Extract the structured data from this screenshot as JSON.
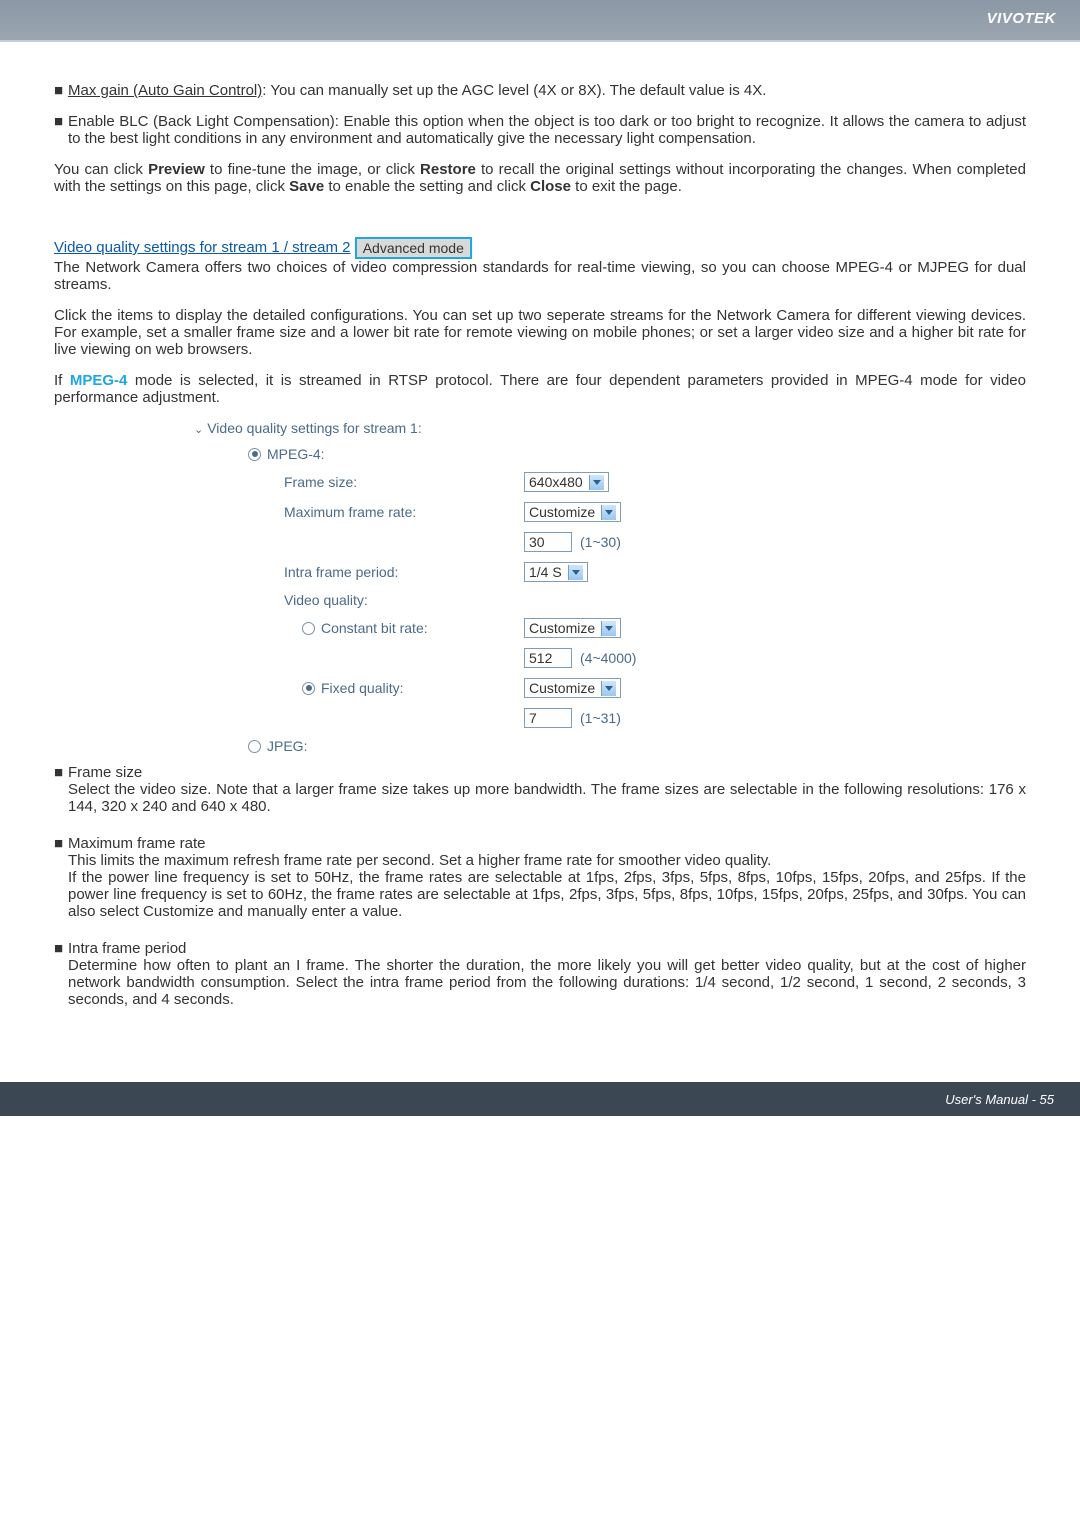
{
  "header": {
    "brand": "VIVOTEK"
  },
  "bullets_top": [
    {
      "lead": "Max gain (Auto Gain Control)",
      "rest": ": You can manually set up the AGC level (4X or 8X). The default value is 4X."
    },
    {
      "text": "Enable BLC (Back Light Compensation): Enable this option when the object is too dark or too bright to recognize. It allows the camera to adjust to the best light conditions in any environment and automatically give the necessary light compensation."
    }
  ],
  "para_preview": {
    "a": "You can click ",
    "b": "Preview",
    "c": " to fine-tune the image, or click ",
    "d": "Restore",
    "e": " to recall the original settings without incorporating the changes. When completed with the settings on this page, click ",
    "f": "Save",
    "g": " to enable the setting and click ",
    "h": "Close",
    "i": " to exit the page."
  },
  "section_link": "Video quality settings for stream 1 / stream 2",
  "adv_mode": "Advanced mode",
  "para_two_streams": "The Network Camera offers two choices of video compression standards for real-time viewing, so you can choose MPEG-4 or MJPEG for dual streams.",
  "para_click_items": "Click the items to display the detailed configurations. You can set up two seperate streams for the Network Camera for different viewing devices. For example, set a smaller frame size and a lower bit rate for remote viewing on mobile phones; or set a larger video size and a higher bit rate for live viewing on web browsers.",
  "para_mpeg": {
    "a": "If ",
    "b": "MPEG-4",
    "c": " mode is selected, it is streamed in RTSP protocol. There are four dependent parameters provided  in MPEG-4 mode for video performance adjustment."
  },
  "form": {
    "title": "Video quality settings for stream 1:",
    "mpeg4_label": "MPEG-4:",
    "jpeg_label": "JPEG:",
    "rows": {
      "frame_size": "Frame size:",
      "max_rate": "Maximum frame rate:",
      "intra": "Intra frame period:",
      "vq": "Video quality:",
      "cbr": "Constant bit rate:",
      "fq": "Fixed quality:"
    },
    "values": {
      "frame_size": "640x480",
      "max_rate_sel": "Customize",
      "max_rate_num": "30",
      "max_rate_range": "(1~30)",
      "intra": "1/4 S",
      "cbr_sel": "Customize",
      "cbr_num": "512",
      "cbr_range": "(4~4000)",
      "fq_sel": "Customize",
      "fq_num": "7",
      "fq_range": "(1~31)"
    }
  },
  "sub_frame_size_h": "Frame size",
  "sub_frame_size_t": "Select the video size. Note that a larger frame size takes up more bandwidth. The frame sizes are selectable in the following resolutions: 176 x 144, 320 x 240 and 640 x 480.",
  "sub_max_rate_h": "Maximum frame rate",
  "sub_max_rate_t1": "This limits the maximum refresh frame rate per second. Set a higher frame rate for smoother video quality.",
  "sub_max_rate_t2": "If the power line frequency is set to 50Hz, the frame rates are selectable at 1fps, 2fps, 3fps, 5fps, 8fps, 10fps, 15fps, 20fps, and 25fps. If the power line frequency is set to 60Hz, the frame rates are selectable at 1fps, 2fps, 3fps, 5fps, 8fps, 10fps, 15fps, 20fps, 25fps, and 30fps. You can also select Customize and manually enter a value.",
  "sub_intra_h": "Intra frame period",
  "sub_intra_t": "Determine how often to plant an I frame. The shorter the duration, the more likely you will get better video quality, but at the cost of higher network bandwidth consumption. Select the intra frame period from the following durations: 1/4 second, 1/2 second, 1 second, 2 seconds, 3 seconds, and 4 seconds.",
  "footer": "User's Manual - 55"
}
